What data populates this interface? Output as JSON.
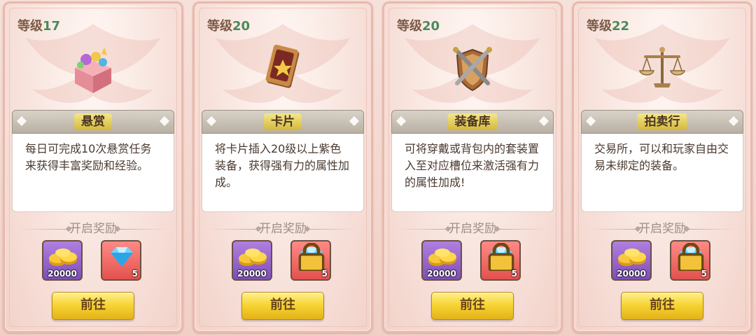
{
  "cards": [
    {
      "level_label": "等级",
      "level_value": "17",
      "icon": "treasure-box-icon",
      "title": "悬赏",
      "description": "每日可完成10次悬赏任务来获得丰富奖励和经验。",
      "reward_header": "开启奖励",
      "rewards": [
        {
          "icon": "gold-coins-icon",
          "qty": "20000"
        },
        {
          "icon": "blue-gem-icon",
          "qty": "5"
        }
      ],
      "button": "前往"
    },
    {
      "level_label": "等级",
      "level_value": "20",
      "icon": "card-icon",
      "title": "卡片",
      "description": "将卡片插入20级以上紫色装备，获得强有力的属性加成。",
      "reward_header": "开启奖励",
      "rewards": [
        {
          "icon": "gold-coins-icon",
          "qty": "20000"
        },
        {
          "icon": "blue-gem-icon",
          "qty": "5"
        }
      ],
      "button": "前往"
    },
    {
      "level_label": "等级",
      "level_value": "20",
      "icon": "shield-swords-icon",
      "title": "装备库",
      "description": "可将穿戴或背包内的套装置入至对应槽位来激活强有力的属性加成!",
      "reward_header": "开启奖励",
      "rewards": [
        {
          "icon": "gold-coins-icon",
          "qty": "20000"
        },
        {
          "icon": "blue-gem-icon",
          "qty": "5"
        }
      ],
      "button": "前往"
    },
    {
      "level_label": "等级",
      "level_value": "22",
      "icon": "scales-icon",
      "title": "拍卖行",
      "description": "交易所，可以和玩家自由交易未绑定的装备。",
      "reward_header": "开启奖励",
      "rewards": [
        {
          "icon": "gold-coins-icon",
          "qty": "20000"
        },
        {
          "icon": "blue-gem-icon",
          "qty": "5"
        }
      ],
      "button": "前往"
    }
  ],
  "colors": {
    "level_number": "#4a8a5c",
    "title_highlight": "#e8d25a",
    "button_gold": "#f6d231",
    "gold_slot": "#9a65cf",
    "gem_slot": "#ef6a66"
  }
}
